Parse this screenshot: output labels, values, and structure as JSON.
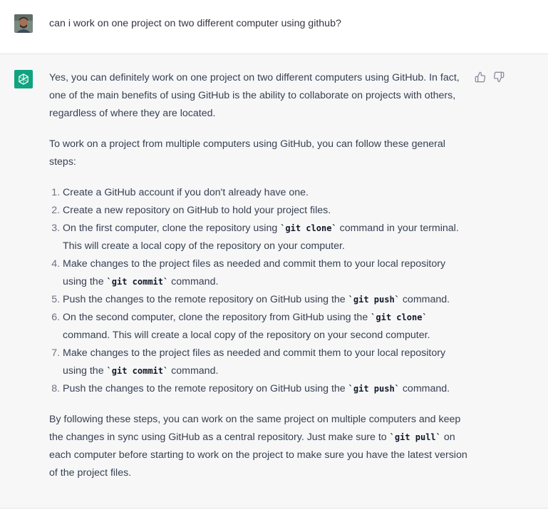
{
  "user": {
    "message": "can i work on one project on two different computer using github?"
  },
  "assistant": {
    "intro": "Yes, you can definitely work on one project on two different computers using GitHub. In fact, one of the main benefits of using GitHub is the ability to collaborate on projects with others, regardless of where they are located.",
    "steps_intro": "To work on a project from multiple computers using GitHub, you can follow these general steps:",
    "steps": [
      {
        "before": "Create a GitHub account if you don't already have one.",
        "code": "",
        "after": ""
      },
      {
        "before": "Create a new repository on GitHub to hold your project files.",
        "code": "",
        "after": ""
      },
      {
        "before": "On the first computer, clone the repository using ",
        "code": "`git clone`",
        "after": " command in your terminal. This will create a local copy of the repository on your computer."
      },
      {
        "before": "Make changes to the project files as needed and commit them to your local repository using the ",
        "code": "`git commit`",
        "after": " command."
      },
      {
        "before": "Push the changes to the remote repository on GitHub using the ",
        "code": "`git push`",
        "after": " command."
      },
      {
        "before": "On the second computer, clone the repository from GitHub using the ",
        "code": "`git clone`",
        "after": " command. This will create a local copy of the repository on your second computer."
      },
      {
        "before": "Make changes to the project files as needed and commit them to your local repository using the ",
        "code": "`git commit`",
        "after": " command."
      },
      {
        "before": "Push the changes to the remote repository on GitHub using the ",
        "code": "`git push`",
        "after": " command."
      }
    ],
    "outro_before": "By following these steps, you can work on the same project on multiple computers and keep the changes in sync using GitHub as a central repository. Just make sure to ",
    "outro_code": "`git pull`",
    "outro_after": " on each computer before starting to work on the project to make sure you have the latest version of the project files."
  },
  "icons": {
    "user_avatar": "user-avatar",
    "bot_avatar": "openai-logo-icon",
    "thumbs_up": "thumbs-up-icon",
    "thumbs_down": "thumbs-down-icon"
  },
  "colors": {
    "bot_avatar_bg": "#10a37f",
    "assistant_bg": "#f7f7f8"
  }
}
